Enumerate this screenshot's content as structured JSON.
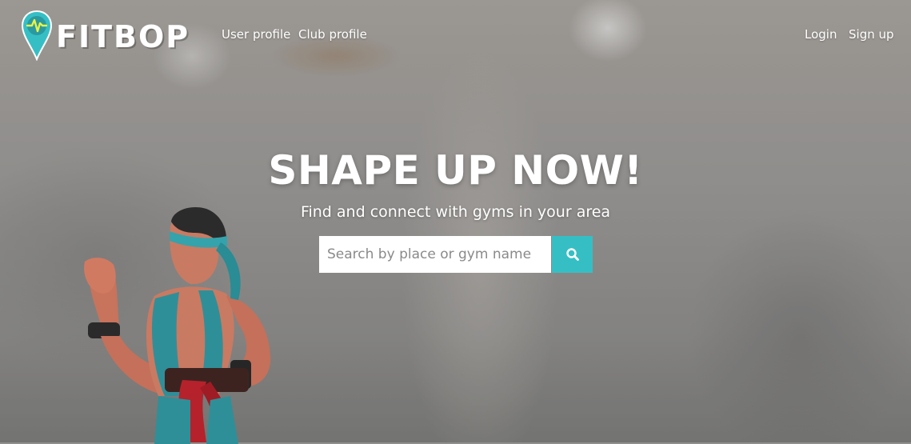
{
  "brand": {
    "name": "FITBOP",
    "icon": "map-pin-pulse-icon",
    "accent": "#35bfc5"
  },
  "nav": {
    "left_links": [
      {
        "label": "User profile"
      },
      {
        "label": "Club profile"
      }
    ],
    "right_links": [
      {
        "label": "Login"
      },
      {
        "label": "Sign up"
      }
    ]
  },
  "hero": {
    "headline": "SHAPE UP NOW!",
    "subheadline": "Find and connect with gyms in your area",
    "search": {
      "placeholder": "Search by place or gym name",
      "value": "",
      "button_icon": "search-icon"
    },
    "background_image": "action-figure-photo"
  }
}
